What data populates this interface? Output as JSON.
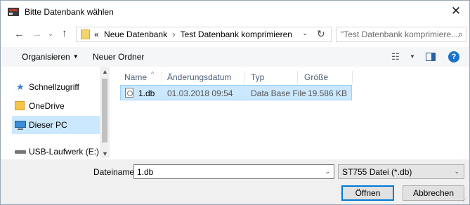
{
  "window": {
    "title": "Bitte Datenbank wählen"
  },
  "address": {
    "crumbs": [
      "«",
      "Neue Datenbank",
      "Test Datenbank komprimieren"
    ],
    "separator": "›"
  },
  "search": {
    "placeholder": "\"Test Datenbank komprimiere..."
  },
  "toolbar": {
    "organize_label": "Organisieren",
    "new_folder_label": "Neuer Ordner"
  },
  "nav": {
    "items": [
      {
        "label": "Schnellzugriff",
        "icon": "star-icon"
      },
      {
        "label": "OneDrive",
        "icon": "onedrive-folder-icon"
      },
      {
        "label": "Dieser PC",
        "icon": "pc-icon",
        "selected": true
      },
      {
        "label": "USB-Laufwerk (E:)",
        "icon": "usb-drive-icon"
      }
    ]
  },
  "filelist": {
    "columns": [
      "Name",
      "Änderungsdatum",
      "Typ",
      "Größe"
    ],
    "rows": [
      {
        "name": "1.db",
        "date": "01.03.2018 09:54",
        "type": "Data Base File",
        "size": "19.586 KB"
      }
    ]
  },
  "bottom": {
    "filename_label": "Dateiname:",
    "filename_value": "1.db",
    "filetype_value": "ST755 Datei (*.db)",
    "open_label": "Öffnen",
    "cancel_label": "Abbrechen"
  },
  "colors": {
    "selection": "#cce8ff",
    "accent": "#0078d7"
  }
}
